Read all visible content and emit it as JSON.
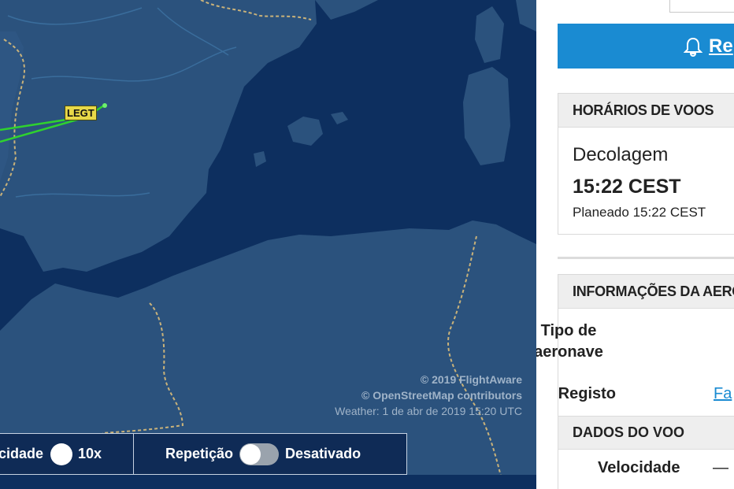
{
  "map": {
    "airport_label": "LEGT",
    "credits": {
      "copyright": "© 2019 FlightAware",
      "osm": "© OpenStreetMap contributors",
      "weather": "Weather: 1 de abr de 2019 15:20 UTC"
    },
    "controls": {
      "speed_label": "cidade",
      "speed_value": "10x",
      "replay_label": "Repetição",
      "replay_state": "Desativado"
    },
    "colors": {
      "sea": "#0d2f5f",
      "land": "#2b527d",
      "route": "#2fd12f",
      "border": "#c9b27a"
    }
  },
  "panel": {
    "alert_button": "Re",
    "schedule": {
      "header": "HORÁRIOS DE VOOS",
      "label": "Decolagem",
      "time": "15:22 CEST",
      "planned": "Planeado 15:22 CEST"
    },
    "aircraft": {
      "header": "INFORMAÇÕES DA AERONAVE",
      "type_label": "Tipo de aeronave",
      "registration_label": "Registo",
      "registration_value": "Fa"
    },
    "flight_data": {
      "header": "DADOS DO VOO",
      "speed_label": "Velocidade",
      "speed_value": "—"
    },
    "accent_color": "#1a8bd2"
  }
}
